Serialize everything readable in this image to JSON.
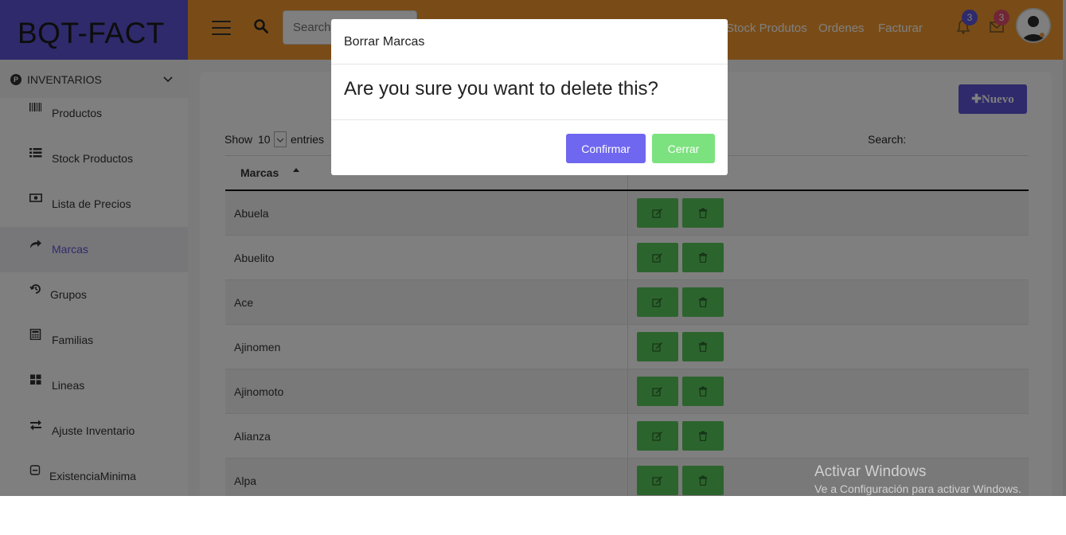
{
  "brand": {
    "name": "BQT-FACT"
  },
  "navbar": {
    "search_placeholder": "Search",
    "links": [
      "Stock Produtos",
      "Ordenes",
      "Facturar"
    ],
    "notifications_count": "3",
    "messages_count": "3"
  },
  "sidebar": {
    "section_badge": "P",
    "section_title": "INVENTARIOS",
    "items": [
      {
        "label": "Productos",
        "icon": "barcode-icon"
      },
      {
        "label": "Stock Productos",
        "icon": "list-icon"
      },
      {
        "label": "Lista de Precios",
        "icon": "money-icon"
      },
      {
        "label": "Marcas",
        "icon": "share-icon",
        "active": true
      },
      {
        "label": "Grupos",
        "icon": "history-icon"
      },
      {
        "label": "Familias",
        "icon": "calculator-icon"
      },
      {
        "label": "Lineas",
        "icon": "grid-icon"
      },
      {
        "label": "Ajuste Inventario",
        "icon": "exchange-icon"
      },
      {
        "label": "ExistenciaMinima",
        "icon": "minus-square-icon"
      }
    ]
  },
  "content": {
    "new_button": "Nuevo",
    "show_label": "Show",
    "show_value": "10",
    "entries_label": "entries",
    "search_label": "Search:",
    "table": {
      "column": "Marcas",
      "rows": [
        "Abuela",
        "Abuelito",
        "Ace",
        "Ajinomen",
        "Ajinomoto",
        "Alianza",
        "Alpa"
      ]
    }
  },
  "modal": {
    "title": "Borrar Marcas",
    "message": "Are you sure you want to delete this?",
    "confirm_label": "Confirmar",
    "close_label": "Cerrar"
  },
  "watermark": {
    "title": "Activar Windows",
    "subtitle": "Ve a Configuración para activar Windows."
  },
  "colors": {
    "brand": "#5f55d6",
    "navbar": "#f3992f",
    "action_green": "#58c95b",
    "confirm": "#6f67f0",
    "close": "#7ce27f"
  }
}
